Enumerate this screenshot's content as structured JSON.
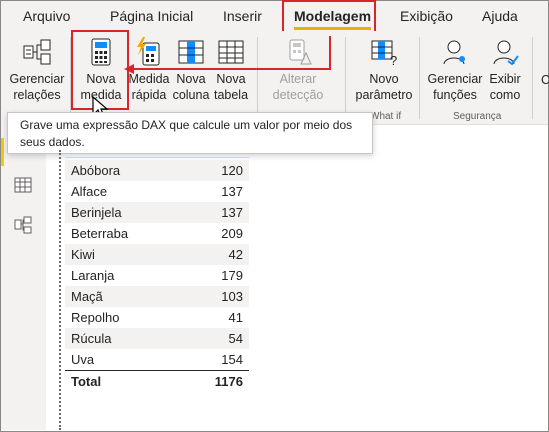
{
  "tabs": [
    "Arquivo",
    "Página Inicial",
    "Inserir",
    "Modelagem",
    "Exibição",
    "Ajuda"
  ],
  "ribbon": {
    "gerenciar_relacoes": [
      "Gerenciar",
      "relações"
    ],
    "nova_medida": [
      "Nova",
      "medida"
    ],
    "medida_rapida": [
      "Medida",
      "rápida"
    ],
    "nova_coluna": [
      "Nova",
      "coluna"
    ],
    "nova_tabela": [
      "Nova",
      "tabela"
    ],
    "alterar_deteccao": [
      "Alterar",
      "detecção"
    ],
    "novo_parametro": [
      "Novo",
      "parâmetro"
    ],
    "gerenciar_funcoes": [
      "Gerenciar",
      "funções"
    ],
    "exibir_como": [
      "Exibir",
      "como"
    ],
    "group_whatif": "What if",
    "group_seguranca": "Segurança"
  },
  "tooltip": {
    "line1": "Grave uma expressão DAX que calcule um valor por meio dos",
    "line2": "seus dados."
  },
  "table": {
    "rows": [
      {
        "name": "Abóbora",
        "value": "120"
      },
      {
        "name": "Alface",
        "value": "137"
      },
      {
        "name": "Berinjela",
        "value": "137"
      },
      {
        "name": "Beterraba",
        "value": "209"
      },
      {
        "name": "Kiwi",
        "value": "42"
      },
      {
        "name": "Laranja",
        "value": "179"
      },
      {
        "name": "Maçã",
        "value": "103"
      },
      {
        "name": "Repolho",
        "value": "41"
      },
      {
        "name": "Rúcula",
        "value": "54"
      },
      {
        "name": "Uva",
        "value": "154"
      }
    ],
    "total_label": "Total",
    "total_value": "1176"
  },
  "colors": {
    "accent": "#e8b000",
    "highlight_box": "#d9252a",
    "tab_bg": "#f3f2f1"
  }
}
